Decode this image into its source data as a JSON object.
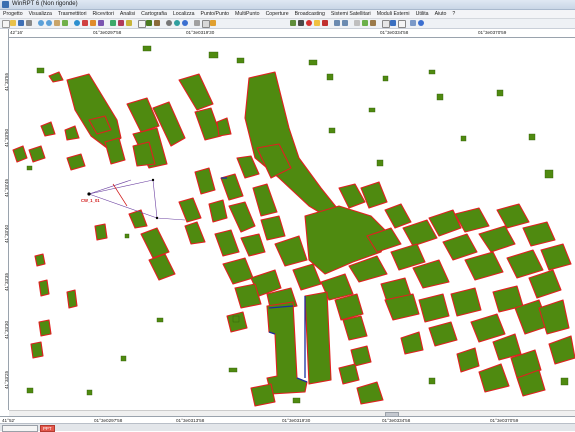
{
  "window": {
    "title": "WinRPT 6 (Non rigonde)"
  },
  "menu": {
    "items": [
      "Progetto",
      "Visualizza",
      "Trasmettitori",
      "Ricevitori",
      "Analisi",
      "Cartografia",
      "Localizza",
      "Punto/Punto",
      "MultiPunto",
      "Coperture",
      "Broadcasting",
      "Sistemi Satellitari",
      "Moduli Esterni",
      "Utilita",
      "Aiuto",
      "?"
    ]
  },
  "coords": {
    "top": [
      "42°16'",
      "01°3e0297'58",
      "01°3e0319'30",
      "01°3e0334'58",
      "01°3e0370'59"
    ],
    "left": [
      "41°33'55",
      "41°33'50",
      "41°33'45",
      "41°33'40",
      "41°33'35",
      "41°33'30",
      "41°33'25"
    ],
    "bottom": [
      "41°52'",
      "01°3e0297'58",
      "01°3e0313'58",
      "01°3e0319'30",
      "01°3e0334'58",
      "01°3e0370'59"
    ]
  },
  "map": {
    "transmitter_label": "CW_1_01",
    "building_fill": "#4f8a10",
    "outline_color": "#e02020",
    "accent_color": "#1a2fa0",
    "line_color": "#6a3fa0"
  },
  "status": {
    "tabs": [
      "",
      "PPT"
    ]
  }
}
